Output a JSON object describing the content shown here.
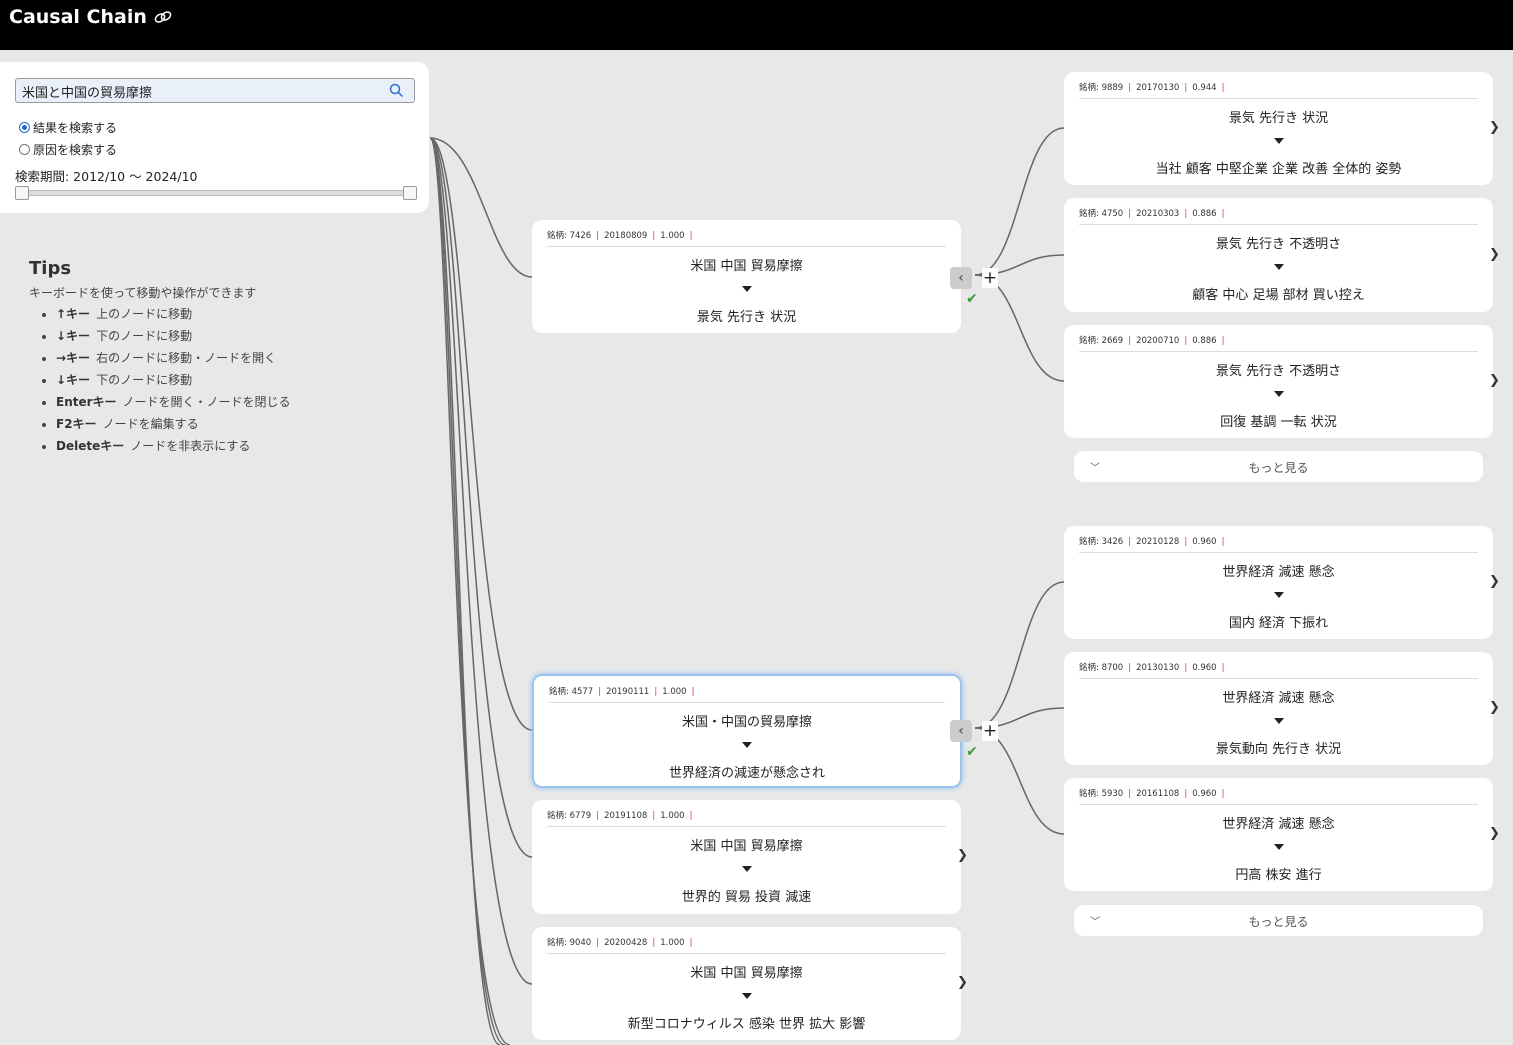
{
  "app": {
    "title": "Causal Chain",
    "title_icon": "link-icon"
  },
  "search": {
    "value": "米国と中国の貿易摩擦",
    "placeholder": ""
  },
  "mode": {
    "options": [
      "結果を検索する",
      "原因を検索する"
    ],
    "selected": 0
  },
  "period": {
    "label": "検索期間: 2012/10 〜 2024/10",
    "range_start_fraction": 0,
    "range_end_fraction": 1
  },
  "tips": {
    "title": "Tips",
    "description": "キーボードを使って移動や操作ができます",
    "items": [
      {
        "key": "↑キー",
        "text": "上のノードに移動"
      },
      {
        "key": "↓キー",
        "text": "下のノードに移動"
      },
      {
        "key": "→キー",
        "text": "右のノードに移動・ノードを開く"
      },
      {
        "key": "↓キー",
        "text": "下のノードに移動"
      },
      {
        "key": "Enterキー",
        "text": "ノードを開く・ノードを閉じる"
      },
      {
        "key": "F2キー",
        "text": "ノードを編集する"
      },
      {
        "key": "Deleteキー",
        "text": "ノードを非表示にする"
      }
    ]
  },
  "column1": [
    {
      "code": "銘柄: 7426",
      "date": "20180809",
      "score": "1.000",
      "cause": "米国 中国 貿易摩擦",
      "effect": "景気 先行き 状況",
      "state": "expanded"
    },
    {
      "code": "銘柄: 4577",
      "date": "20190111",
      "score": "1.000",
      "cause": "米国・中国の貿易摩擦",
      "effect": "世界経済の減速が懸念され",
      "state": "expanded",
      "selected": true
    },
    {
      "code": "銘柄: 6779",
      "date": "20191108",
      "score": "1.000",
      "cause": "米国 中国 貿易摩擦",
      "effect": "世界的 貿易 投資 減速",
      "state": "collapsed"
    },
    {
      "code": "銘柄: 9040",
      "date": "20200428",
      "score": "1.000",
      "cause": "米国 中国 貿易摩擦",
      "effect": "新型コロナウィルス 感染 世界 拡大 影響",
      "state": "collapsed"
    }
  ],
  "column2a": [
    {
      "code": "銘柄: 9889",
      "date": "20170130",
      "score": "0.944",
      "cause": "景気 先行き 状況",
      "effect": "当社 顧客 中堅企業 企業 改善 全体的 姿勢"
    },
    {
      "code": "銘柄: 4750",
      "date": "20210303",
      "score": "0.886",
      "cause": "景気 先行き 不透明さ",
      "effect": "顧客 中心 足場 部材 買い控え"
    },
    {
      "code": "銘柄: 2669",
      "date": "20200710",
      "score": "0.886",
      "cause": "景気 先行き 不透明さ",
      "effect": "回復 基調 一転 状況"
    }
  ],
  "column2b": [
    {
      "code": "銘柄: 3426",
      "date": "20210128",
      "score": "0.960",
      "cause": "世界経済 減速 懸念",
      "effect": "国内 経済 下振れ"
    },
    {
      "code": "銘柄: 8700",
      "date": "20130130",
      "score": "0.960",
      "cause": "世界経済 減速 懸念",
      "effect": "景気動向 先行き 状況"
    },
    {
      "code": "銘柄: 5930",
      "date": "20161108",
      "score": "0.960",
      "cause": "世界経済 減速 懸念",
      "effect": "円高 株安 進行"
    }
  ],
  "more_label": "もっと見る",
  "icons": {
    "expand": "chevron-right-icon",
    "collapse": "chevron-left-icon",
    "add": "plus-icon",
    "check": "check-icon",
    "more": "chevron-down-icon",
    "search": "search-icon"
  },
  "colors": {
    "topbar": "#000000",
    "background": "#e8e8e8",
    "selected_border": "#9cc4ec",
    "check": "#3a9a3a",
    "separator": "#dd3333"
  }
}
